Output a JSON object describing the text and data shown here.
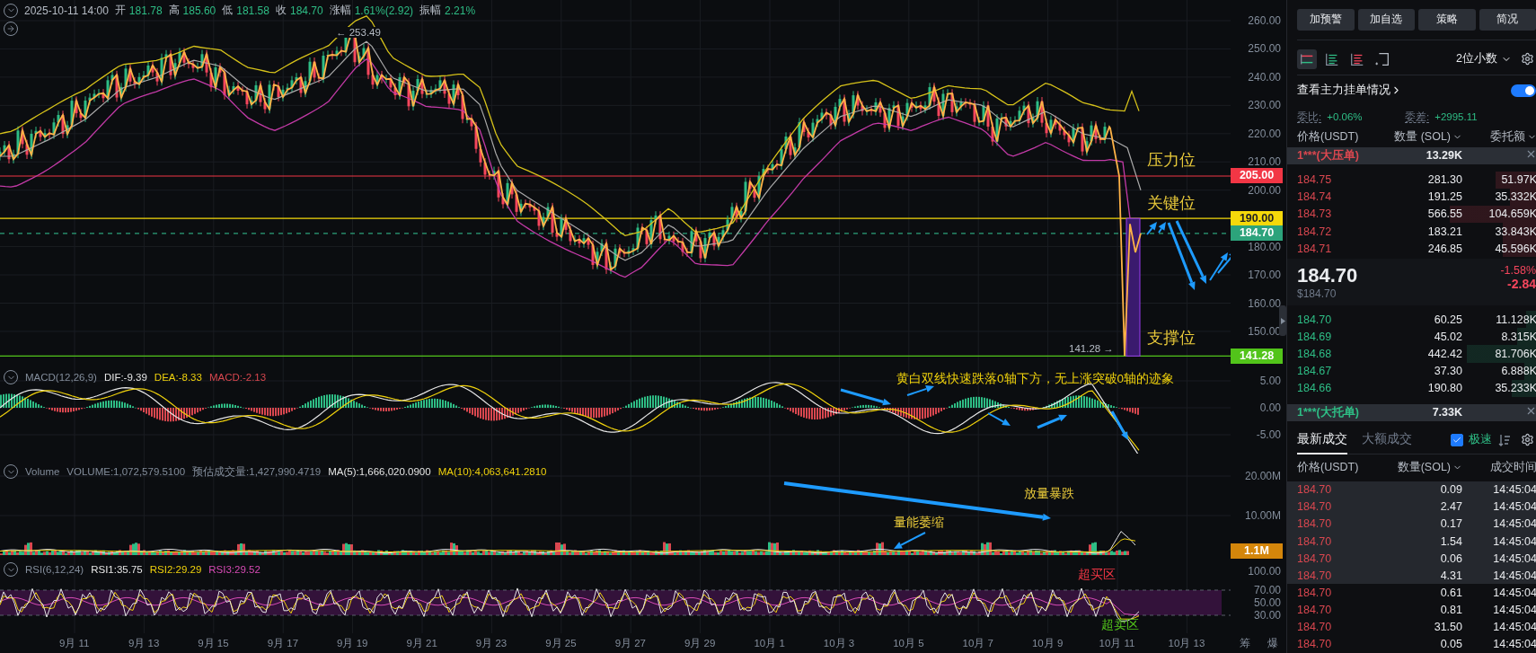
{
  "info_bar": {
    "datetime": "2025-10-11 14:00",
    "fields": [
      {
        "label": "开",
        "value": "181.78"
      },
      {
        "label": "高",
        "value": "185.60"
      },
      {
        "label": "低",
        "value": "181.58"
      },
      {
        "label": "收",
        "value": "184.70"
      },
      {
        "label": "涨幅",
        "value": "1.61%(2.92)"
      },
      {
        "label": "振幅",
        "value": "2.21%"
      }
    ]
  },
  "price_pane": {
    "axis_ticks": [
      "260.00",
      "250.00",
      "240.00",
      "230.00",
      "220.00",
      "210.00",
      "200.00",
      "180.00",
      "170.00",
      "160.00",
      "150.00"
    ],
    "levels": [
      {
        "value": "205.00",
        "color": "#f23645",
        "kind": "solid"
      },
      {
        "value": "190.00",
        "color": "#f5d90a",
        "kind": "solid"
      },
      {
        "value": "184.70",
        "color": "#2ca37b",
        "kind": "dashed"
      },
      {
        "value": "141.28",
        "color": "#52c41a",
        "kind": "solid"
      }
    ],
    "high_label": "← 253.49",
    "low_label": "141.28 →",
    "annotations": [
      "压力位",
      "关键位",
      "支撑位"
    ]
  },
  "macd_pane": {
    "title": "MACD(12,26,9)",
    "values": [
      {
        "text": "DIF:-9.39",
        "color": "#e6e6e6"
      },
      {
        "text": "DEA:-8.33",
        "color": "#f0d20c"
      },
      {
        "text": "MACD:-2.13",
        "color": "#d9474f"
      }
    ],
    "axis_ticks": [
      "5.00",
      "0.00",
      "-5.00"
    ],
    "note": "黄白双线快速跌落0轴下方，无上涨突破0轴的迹象"
  },
  "volume_pane": {
    "title": "Volume",
    "values": [
      {
        "text": "VOLUME:1,072,579.5100",
        "color": "#848e9c"
      },
      {
        "text": "预估成交量:1,427,990.4719",
        "color": "#848e9c"
      },
      {
        "text": "MA(5):1,666,020.0900",
        "color": "#e6e6e6"
      },
      {
        "text": "MA(10):4,063,641.2810",
        "color": "#f0d20c"
      }
    ],
    "axis_ticks": [
      "20.00M",
      "10.00M"
    ],
    "current": "1.1M",
    "notes": [
      "放量暴跌",
      "量能萎缩"
    ]
  },
  "rsi_pane": {
    "title": "RSI(6,12,24)",
    "values": [
      {
        "text": "RSI1:35.75",
        "color": "#e6e6e6"
      },
      {
        "text": "RSI2:29.29",
        "color": "#f0d20c"
      },
      {
        "text": "RSI3:29.52",
        "color": "#d84bb6"
      }
    ],
    "axis_ticks": [
      "100.00",
      "70.00",
      "50.00",
      "30.00"
    ],
    "notes": [
      {
        "text": "超买区",
        "color": "#f23645"
      },
      {
        "text": "超卖区",
        "color": "#52c41a"
      }
    ]
  },
  "x_axis": {
    "labels": [
      "9月 11",
      "9月 13",
      "9月 15",
      "9月 17",
      "9月 19",
      "9月 21",
      "9月 23",
      "9月 25",
      "9月 27",
      "9月 29",
      "10月 1",
      "10月 3",
      "10月 5",
      "10月 7",
      "10月 9",
      "10月 11",
      "10月 13"
    ],
    "corner": [
      "筹",
      "爆"
    ]
  },
  "side_panel": {
    "actions": [
      "加预警",
      "加自选",
      "策略",
      "简况"
    ],
    "view_modes": [
      {
        "kind": "both",
        "selected": true
      },
      {
        "kind": "bids",
        "selected": false
      },
      {
        "kind": "asks",
        "selected": false
      },
      {
        "kind": "custom",
        "selected": false
      }
    ],
    "precision": "2位小数",
    "main_orders": {
      "label": "查看主力挂单情况",
      "on": true
    },
    "ratio": {
      "label": "委比:",
      "value": "+0.06%"
    },
    "diff": {
      "label": "委差:",
      "value": "+2995.11"
    },
    "book_columns": [
      {
        "label": "价格(USDT)",
        "sortable": false
      },
      {
        "label": "数量 (SOL)",
        "sortable": true
      },
      {
        "label": "委托额",
        "sortable": true
      }
    ],
    "big_ask": {
      "label": "1***(大压单)",
      "amount": "13.29K"
    },
    "asks": [
      {
        "price": "184.75",
        "qty": "281.30",
        "total": "51.97K"
      },
      {
        "price": "184.74",
        "qty": "191.25",
        "total": "35.332K"
      },
      {
        "price": "184.73",
        "qty": "566.55",
        "total": "104.659K"
      },
      {
        "price": "184.72",
        "qty": "183.21",
        "total": "33.843K"
      },
      {
        "price": "184.71",
        "qty": "246.85",
        "total": "45.596K"
      }
    ],
    "last": {
      "price": "184.70",
      "usd": "$184.70",
      "change_pct": "-1.58%",
      "change": "-2.84"
    },
    "bids": [
      {
        "price": "184.70",
        "qty": "60.25",
        "total": "11.128K"
      },
      {
        "price": "184.69",
        "qty": "45.02",
        "total": "8.315K"
      },
      {
        "price": "184.68",
        "qty": "442.42",
        "total": "81.706K"
      },
      {
        "price": "184.67",
        "qty": "37.30",
        "total": "6.888K"
      },
      {
        "price": "184.66",
        "qty": "190.80",
        "total": "35.233K"
      }
    ],
    "big_bid": {
      "label": "1***(大托单)",
      "amount": "7.33K"
    },
    "trade_tabs": [
      {
        "label": "最新成交",
        "selected": true
      },
      {
        "label": "大额成交",
        "selected": false
      }
    ],
    "fast_mode": {
      "label": "极速",
      "checked": true
    },
    "trade_columns": [
      {
        "label": "价格(USDT)",
        "sortable": false
      },
      {
        "label": "数量(SOL)",
        "sortable": true
      },
      {
        "label": "成交时间",
        "sortable": false
      }
    ],
    "trades": [
      {
        "price": "184.70",
        "qty": "0.09",
        "time": "14:45:04",
        "highlighted": true
      },
      {
        "price": "184.70",
        "qty": "2.47",
        "time": "14:45:04",
        "highlighted": true
      },
      {
        "price": "184.70",
        "qty": "0.17",
        "time": "14:45:04",
        "highlighted": true
      },
      {
        "price": "184.70",
        "qty": "1.54",
        "time": "14:45:04",
        "highlighted": true
      },
      {
        "price": "184.70",
        "qty": "0.06",
        "time": "14:45:04",
        "highlighted": true
      },
      {
        "price": "184.70",
        "qty": "4.31",
        "time": "14:45:04",
        "highlighted": true
      },
      {
        "price": "184.70",
        "qty": "0.61",
        "time": "14:45:04",
        "highlighted": false
      },
      {
        "price": "184.70",
        "qty": "0.81",
        "time": "14:45:04",
        "highlighted": false
      },
      {
        "price": "184.70",
        "qty": "31.50",
        "time": "14:45:04",
        "highlighted": false
      },
      {
        "price": "184.70",
        "qty": "0.05",
        "time": "14:45:04",
        "highlighted": false
      }
    ]
  }
}
